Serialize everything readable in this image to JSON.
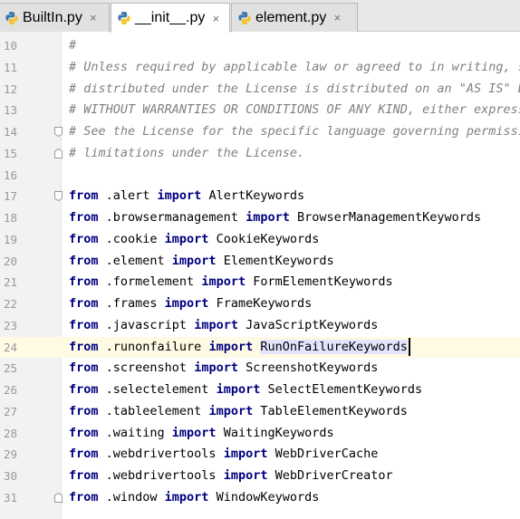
{
  "tabs": [
    {
      "label": "BuiltIn.py",
      "active": false
    },
    {
      "label": "__init__.py",
      "active": true
    },
    {
      "label": "element.py",
      "active": false
    }
  ],
  "close_symbol": "×",
  "lines": [
    {
      "num": "10",
      "comment": "#"
    },
    {
      "num": "11",
      "comment": "# Unless required by applicable law or agreed to in writing, s"
    },
    {
      "num": "12",
      "comment": "# distributed under the License is distributed on an \"AS IS\" B"
    },
    {
      "num": "13",
      "comment": "# WITHOUT WARRANTIES OR CONDITIONS OF ANY KIND, either express"
    },
    {
      "num": "14",
      "comment": "# See the License for the specific language governing permissi"
    },
    {
      "num": "15",
      "comment": "# limitations under the License."
    },
    {
      "num": "16",
      "comment": ""
    },
    {
      "num": "17",
      "from": "from",
      "module": " .alert ",
      "import": "import",
      "name": " AlertKeywords"
    },
    {
      "num": "18",
      "from": "from",
      "module": " .browsermanagement ",
      "import": "import",
      "name": " BrowserManagementKeywords"
    },
    {
      "num": "19",
      "from": "from",
      "module": " .cookie ",
      "import": "import",
      "name": " CookieKeywords"
    },
    {
      "num": "20",
      "from": "from",
      "module": " .element ",
      "import": "import",
      "name": " ElementKeywords"
    },
    {
      "num": "21",
      "from": "from",
      "module": " .formelement ",
      "import": "import",
      "name": " FormElementKeywords"
    },
    {
      "num": "22",
      "from": "from",
      "module": " .frames ",
      "import": "import",
      "name": " FrameKeywords"
    },
    {
      "num": "23",
      "from": "from",
      "module": " .javascript ",
      "import": "import",
      "name": " JavaScriptKeywords"
    },
    {
      "num": "24",
      "from": "from",
      "module": " .runonfailure ",
      "import": "import",
      "name": " RunOnFailureKeywords"
    },
    {
      "num": "25",
      "from": "from",
      "module": " .screenshot ",
      "import": "import",
      "name": " ScreenshotKeywords"
    },
    {
      "num": "26",
      "from": "from",
      "module": " .selectelement ",
      "import": "import",
      "name": " SelectElementKeywords"
    },
    {
      "num": "27",
      "from": "from",
      "module": " .tableelement ",
      "import": "import",
      "name": " TableElementKeywords"
    },
    {
      "num": "28",
      "from": "from",
      "module": " .waiting ",
      "import": "import",
      "name": " WaitingKeywords"
    },
    {
      "num": "29",
      "from": "from",
      "module": " .webdrivertools ",
      "import": "import",
      "name": " WebDriverCache"
    },
    {
      "num": "30",
      "from": "from",
      "module": " .webdrivertools ",
      "import": "import",
      "name": " WebDriverCreator"
    },
    {
      "num": "31",
      "from": "from",
      "module": " .window ",
      "import": "import",
      "name": " WindowKeywords"
    }
  ],
  "current_line": "24",
  "selected_word_line": "24",
  "fold_markers": [
    "14",
    "15",
    "17",
    "31"
  ],
  "icons": {
    "tab": "python-file-icon",
    "close": "close-icon",
    "fold": "fold-marker-icon"
  },
  "colors": {
    "keyword": "#000080",
    "comment": "#808080",
    "current_line": "#fffae3",
    "selection": "#e4e4ff",
    "gutter": "#f2f2f2"
  }
}
